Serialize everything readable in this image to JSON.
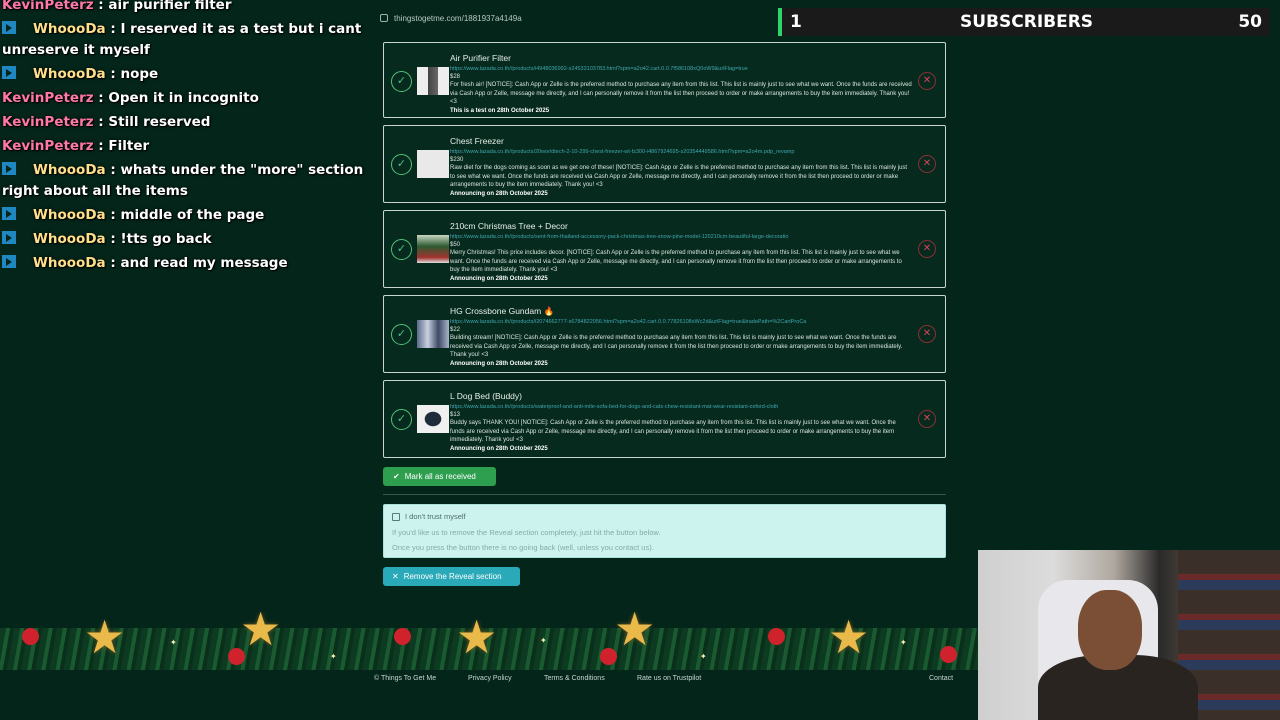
{
  "browser": {
    "url": "thingstogetme.com/1881937a4149a"
  },
  "chat": {
    "partial_top": {
      "user": "KevinPeterz",
      "message": ": air purifier filter"
    },
    "lines": [
      {
        "user": "WhoooDa",
        "message": ": I reserved it as a test but i cant unreserve it myself",
        "badge": true,
        "user_color": "whoo"
      },
      {
        "user": "WhoooDa",
        "message": ": nope",
        "badge": true,
        "user_color": "whoo"
      },
      {
        "user": "KevinPeterz",
        "message": ": Open it in incognito",
        "badge": false,
        "user_color": "kevin"
      },
      {
        "user": "KevinPeterz",
        "message": ": Still reserved",
        "badge": false,
        "user_color": "kevin"
      },
      {
        "user": "KevinPeterz",
        "message": ": Filter",
        "badge": false,
        "user_color": "kevin"
      },
      {
        "user": "WhoooDa",
        "message": ": whats under the \"more\" section right about all the items",
        "badge": true,
        "user_color": "whoo"
      },
      {
        "user": "WhoooDa",
        "message": ": middle of the page",
        "badge": true,
        "user_color": "whoo"
      },
      {
        "user": "WhoooDa",
        "message": ": !tts go back",
        "badge": true,
        "user_color": "whoo"
      },
      {
        "user": "WhoooDa",
        "message": ": and read my message",
        "badge": true,
        "user_color": "whoo"
      }
    ]
  },
  "subscribers": {
    "count": "1",
    "label": "SUBSCRIBERS",
    "goal": "50"
  },
  "items": [
    {
      "title": "Air Purifier Filter",
      "url": "https://www.lazada.co.th//products/i4948036992-s24533103783.html?spm=a2o42.cart.0.0.7f586108xQ0oW9&urlFlag=true",
      "price": "$28",
      "desc": "For fresh air! [NOTICE]: Cash App or Zelle is the preferred method to purchase any item from this list. This list is mainly just to see what we want. Once the funds are received via Cash App or Zelle, message me directly, and I can personally remove it from the list then proceed to order or make arrangements to buy the item immediately. Thank you! <3",
      "date": "This is a test on 28th October 2025",
      "thumb": "t0"
    },
    {
      "title": "Chest Freezer",
      "url": "https://www.lazada.co.th//products/20worldtech-2-10-299-chest-freezer-wt-fz300-i4867924695-s20354449586.html?spm=a2o4m.pdp_revamp",
      "price": "$230",
      "desc": "Raw diet for the dogs coming as soon as we get one of these! [NOTICE]: Cash App or Zelle is the preferred method to purchase any item from this list. This list is mainly just to see what we want. Once the funds are received via Cash App or Zelle, message me directly, and I can personally remove it from the list then proceed to order or make arrangements to buy the item immediately. Thank you! <3",
      "date": "Announcing on 28th October 2025",
      "thumb": "t1"
    },
    {
      "title": "210cm Christmas Tree + Decor",
      "url": "https://www.lazada.co.th//products/sent-from-thailand-accessory-pack-christmas-tree-snow-pine-model-120210cm-beautiful-large-decoratio",
      "price": "$50",
      "desc": "Merry Christmas! This price includes decor. [NOTICE]: Cash App or Zelle is the preferred method to purchase any item from this list. This list is mainly just to see what we want. Once the funds are received via Cash App or Zelle, message me directly, and I can personally remove it from the list then proceed to order or make arrangements to buy the item immediately. Thank you! <3",
      "date": "Announcing on 28th October 2025",
      "thumb": "t2"
    },
    {
      "title": "HG Crossbone Gundam 🔥",
      "url": "https://www.lazada.co.th//products/i2074662777-s6784822056.html?spm=a2o42.cart.0.0.77826108sWc2d&urlFlag=true&tradePath=%2CartProCa",
      "price": "$22",
      "desc": "Building stream! [NOTICE]: Cash App or Zelle is the preferred method to purchase any item from this list. This list is mainly just to see what we want. Once the funds are received via Cash App or Zelle, message me directly, and I can personally remove it from the list then proceed to order or make arrangements to buy the item immediately. Thank you! <3",
      "date": "Announcing on 28th October 2025",
      "thumb": "t3"
    },
    {
      "title": "L Dog Bed (Buddy)",
      "url": "https://www.lazada.co.th//products/waterproof-and-anti-mite-sofa-bed-for-dogs-and-cats-chew-resistant-mat-wear-resistant-oxford-cloth",
      "price": "$13",
      "desc": "Buddy says THANK YOU! [NOTICE]: Cash App or Zelle is the preferred method to purchase any item from this list. This list is mainly just to see what we want. Once the funds are received via Cash App or Zelle, message me directly, and I can personally remove it from the list then proceed to order or make arrangements to buy the item immediately. Thank you! <3",
      "date": "Announcing on 28th October 2025",
      "thumb": "t4"
    }
  ],
  "actions": {
    "mark_all": "Mark all as received",
    "remove_reveal": "Remove the Reveal section"
  },
  "trust": {
    "title": "I don't trust myself",
    "line1": "If you'd like us to remove the Reveal section completely, just hit the button below.",
    "line2": "Once you press the button there is no going back (well, unless you contact us)."
  },
  "footer": {
    "copyright": "© Things To Get Me",
    "privacy": "Privacy Policy",
    "terms": "Terms & Conditions",
    "trustpilot": "Rate us on Trustpilot",
    "contact": "Contact"
  },
  "colors": {
    "background": "#04251a",
    "accent_green": "#2e9e4f",
    "accent_teal": "#2aa9b8",
    "remove_red": "#d9445a"
  }
}
